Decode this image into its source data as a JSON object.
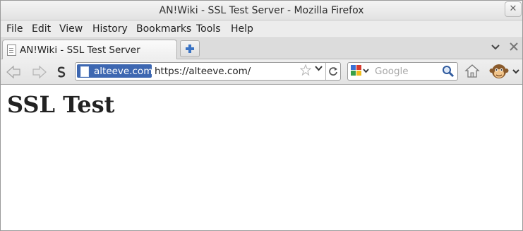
{
  "window": {
    "title": "AN!Wiki - SSL Test Server - Mozilla Firefox"
  },
  "menu": {
    "items": [
      {
        "label": "File"
      },
      {
        "label": "Edit"
      },
      {
        "label": "View"
      },
      {
        "label": "History"
      },
      {
        "label": "Bookmarks"
      },
      {
        "label": "Tools"
      },
      {
        "label": "Help"
      }
    ]
  },
  "tabs": [
    {
      "label": "AN!Wiki - SSL Test Server",
      "active": true
    }
  ],
  "navbar": {
    "identity_label": "alteeve.com",
    "url": "https://alteeve.com/",
    "search_placeholder": "Google"
  },
  "page": {
    "heading": "SSL Test"
  },
  "colors": {
    "identity_bg": "#3d67b1",
    "toolbar_bg": "#e8e8e8",
    "newtab_plus": "#3a73c4"
  },
  "icons": [
    "close-icon",
    "page-favicon",
    "new-tab-icon",
    "tab-list-chevron-icon",
    "close-tab-icon",
    "back-arrow-icon",
    "forward-arrow-icon",
    "s-addon-icon",
    "bookmark-star-icon",
    "reload-icon",
    "google-icon",
    "magnifier-icon",
    "home-icon",
    "monkey-addon-icon"
  ]
}
